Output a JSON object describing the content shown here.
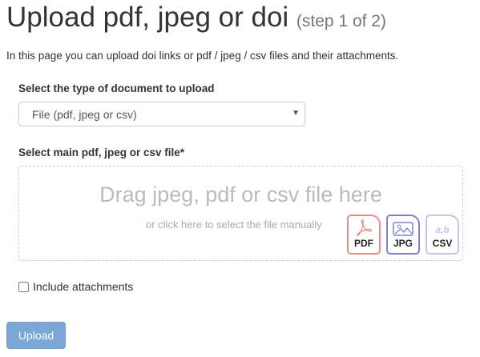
{
  "page": {
    "title": "Upload pdf, jpeg or doi",
    "step": "(step 1 of 2)",
    "intro": "In this page you can upload doi links or pdf / jpeg / csv files and their attachments."
  },
  "doc_type": {
    "label": "Select the type of document to upload",
    "value": "File (pdf, jpeg or csv)"
  },
  "file": {
    "label": "Select main pdf, jpeg or csv file*",
    "drag_text": "Drag jpeg, pdf or csv file here",
    "click_text": "or click here to select the file manually",
    "icons": [
      {
        "name": "pdf-file-icon",
        "label": "PDF",
        "color": "#f08a8a"
      },
      {
        "name": "jpg-file-icon",
        "label": "JPG",
        "color": "#8080d0"
      },
      {
        "name": "csv-file-icon",
        "label": "CSV",
        "color": "#c5c5ec",
        "glyph": "a,b"
      }
    ]
  },
  "attachments": {
    "label": "Include attachments",
    "checked": false
  },
  "submit": {
    "label": "Upload"
  }
}
